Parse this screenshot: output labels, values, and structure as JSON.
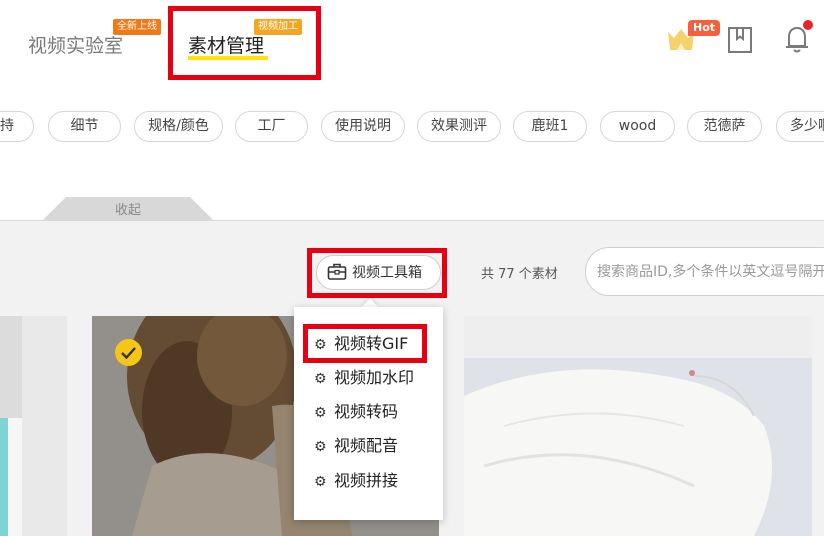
{
  "header": {
    "tabs": [
      {
        "label": "视频实验室",
        "badge": "全新上线",
        "active": false
      },
      {
        "label": "素材管理",
        "badge": "视频加工",
        "active": true
      }
    ],
    "hot_badge": "Hot",
    "icons": [
      "crown-icon",
      "bookmark-icon",
      "bell-icon"
    ],
    "notification_dot": true
  },
  "tags": [
    "持",
    "细节",
    "规格/颜色",
    "工厂",
    "使用说明",
    "效果测评",
    "鹿班1",
    "wood",
    "范德萨",
    "多少啊"
  ],
  "collapse_label": "收起",
  "toolbar": {
    "toolbox_label": "视频工具箱",
    "total_text": "共 77 个素材",
    "search_placeholder": "搜索商品ID,多个条件以英文逗号隔开"
  },
  "toolbox_menu": [
    "视频转GIF",
    "视频加水印",
    "视频转码",
    "视频配音",
    "视频拼接"
  ],
  "colors": {
    "highlight_border": "#e60012",
    "active_underline": "#ffe400",
    "badge_new": "#f07a18",
    "badge_video": "#f2a623",
    "hot": "#f4603e",
    "check": "#f5c518"
  },
  "materials": [
    {
      "selected": false
    },
    {
      "selected": true
    },
    {
      "selected": false
    }
  ]
}
